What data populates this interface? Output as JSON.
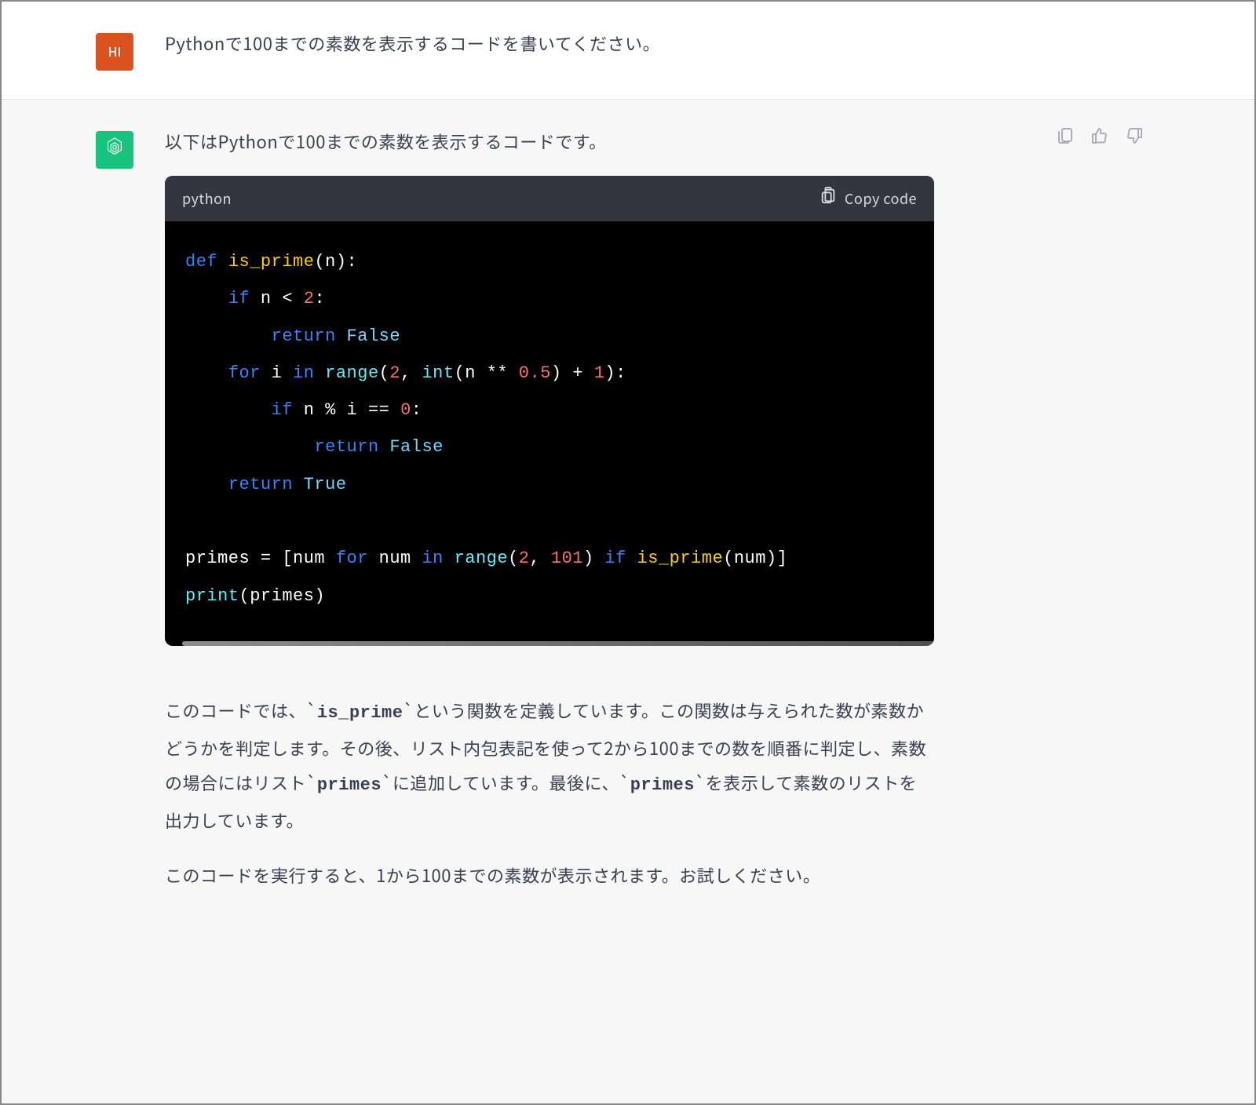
{
  "user": {
    "avatar_text": "HI",
    "message": "Pythonで100までの素数を表示するコードを書いてください。"
  },
  "assistant": {
    "intro": "以下はPythonで100までの素数を表示するコードです。",
    "code_language": "python",
    "copy_label": "Copy code",
    "code_plain": "def is_prime(n):\n    if n < 2:\n        return False\n    for i in range(2, int(n ** 0.5) + 1):\n        if n % i == 0:\n            return False\n    return True\n\nprimes = [num for num in range(2, 101) if is_prime(num)]\nprint(primes)",
    "explanation_parts": {
      "p1a": "このコードでは、`",
      "p1b": "is_prime",
      "p1c": "`という関数を定義しています。この関数は与えられた数が素数かどうかを判定します。その後、リスト内包表記を使って2から100までの数を順番に判定し、素数の場合にはリスト`",
      "p1d": "primes",
      "p1e": "`に追加しています。最後に、`",
      "p1f": "primes",
      "p1g": "`を表示して素数のリストを出力しています。",
      "p2": "このコードを実行すると、1から100までの素数が表示されます。お試しください。"
    }
  },
  "actions": {
    "copy": "copy",
    "like": "like",
    "dislike": "dislike"
  }
}
